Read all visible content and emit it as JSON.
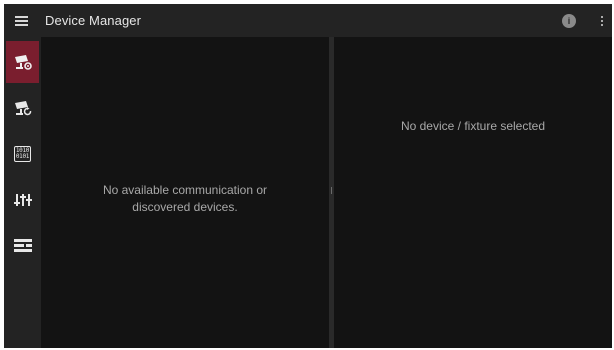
{
  "app": {
    "title": "Device Manager",
    "info_label": "i"
  },
  "rail": {
    "items": [
      {
        "id": "fixture-devices",
        "icon": "camera-gear-icon",
        "active": true
      },
      {
        "id": "discovered-devices",
        "icon": "camera-refresh-icon",
        "active": false
      },
      {
        "id": "binary",
        "icon": "binary-icon",
        "active": false,
        "line1": "1010",
        "line2": "0101"
      },
      {
        "id": "sliders",
        "icon": "sliders-icon",
        "active": false
      },
      {
        "id": "list",
        "icon": "list-icon",
        "active": false
      }
    ]
  },
  "left_panel": {
    "empty_line1": "No available communication or",
    "empty_line2": "discovered devices."
  },
  "right_panel": {
    "empty_text": "No device / fixture selected"
  },
  "colors": {
    "accent": "#7a1e2e",
    "bar": "#232323",
    "background": "#131313"
  }
}
